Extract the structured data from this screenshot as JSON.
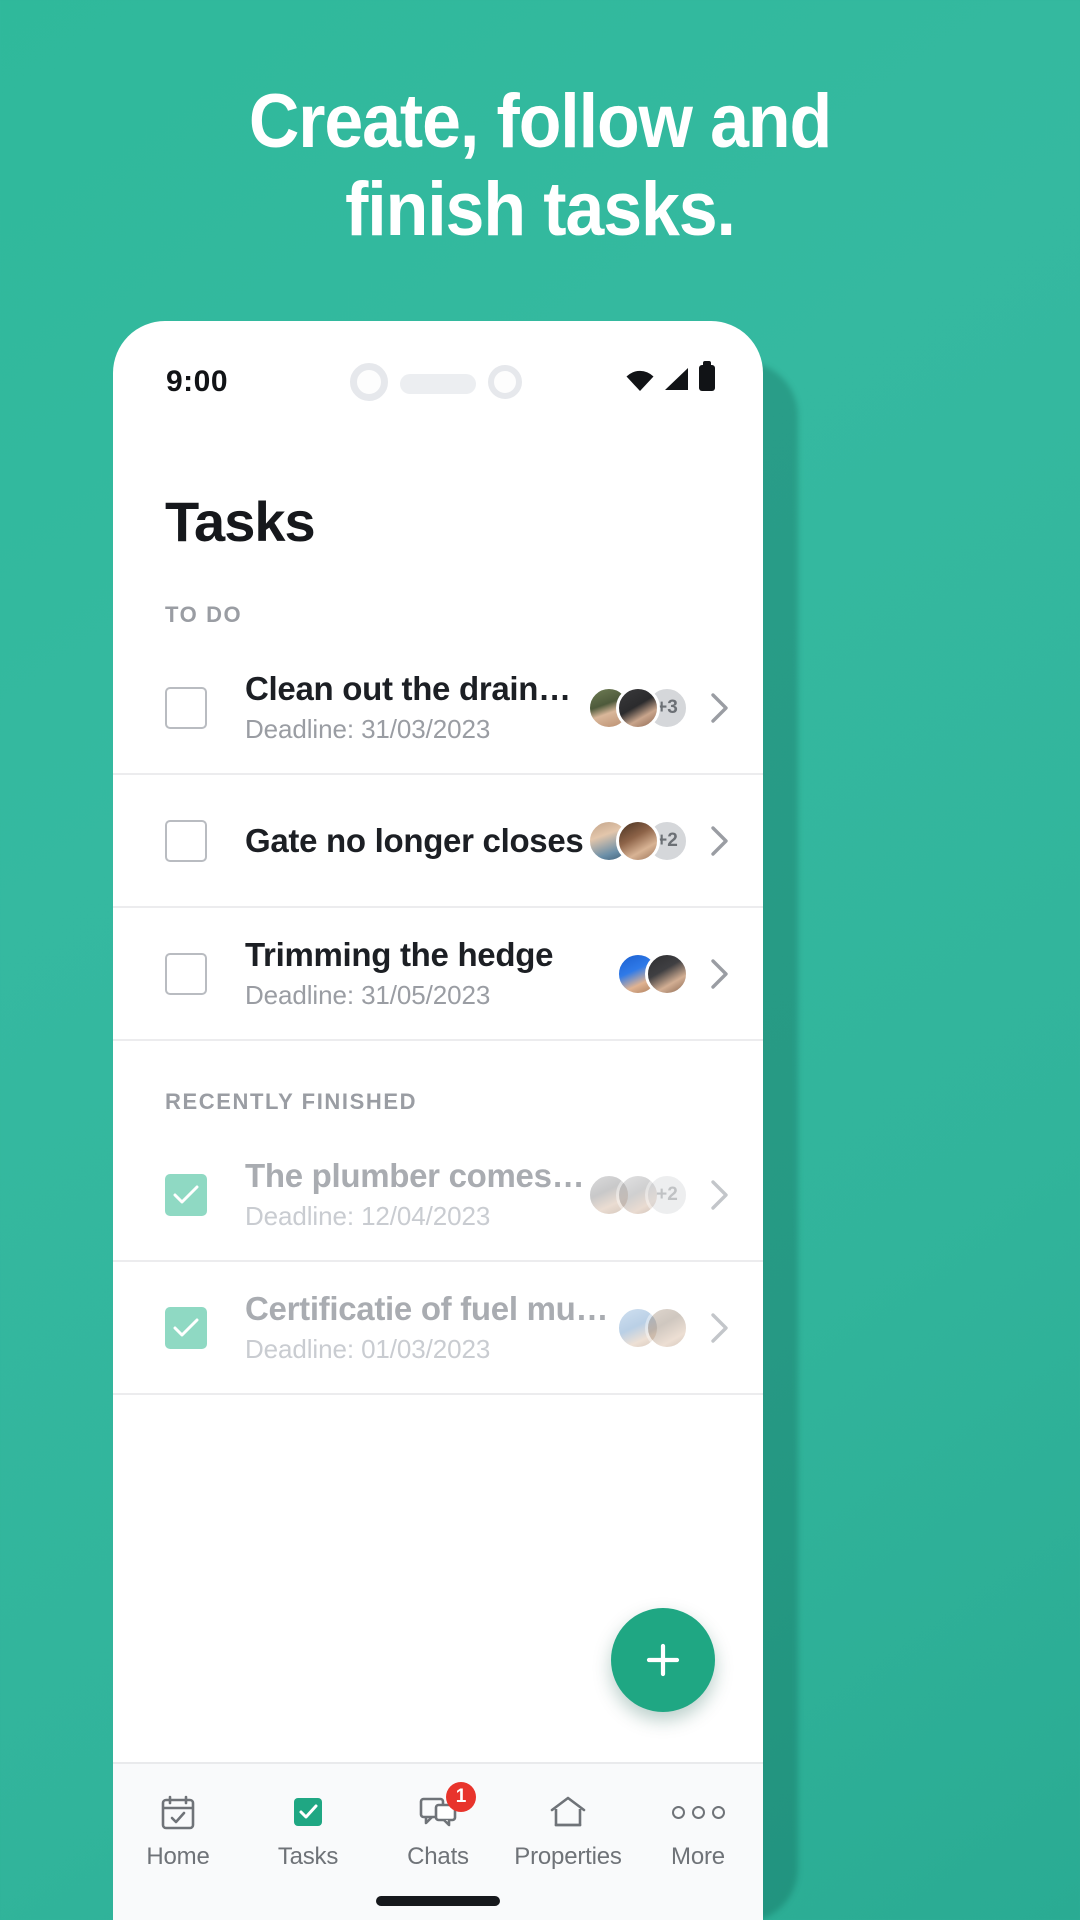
{
  "promo": {
    "headline_line1": "Create, follow and",
    "headline_line2": "finish tasks.",
    "background_color": "#31b49b"
  },
  "phone": {
    "status_bar": {
      "time": "9:00",
      "wifi_icon": "wifi-icon",
      "signal_icon": "cellular-signal-icon",
      "battery_icon": "battery-full-icon"
    },
    "screen": {
      "page_title": "Tasks",
      "sections": [
        {
          "label": "TO DO",
          "tasks": [
            {
              "title": "Clean out the drainpipe",
              "deadline": "Deadline: 31/03/2023",
              "completed": false,
              "avatars": [
                "face-1",
                "face-2"
              ],
              "avatar_overflow": "+3"
            },
            {
              "title": "Gate no longer closes",
              "deadline": "",
              "completed": false,
              "avatars": [
                "face-3",
                "face-4"
              ],
              "avatar_overflow": "+2"
            },
            {
              "title": "Trimming the hedge",
              "deadline": "Deadline: 31/05/2023",
              "completed": false,
              "avatars": [
                "face-5",
                "face-6"
              ],
              "avatar_overflow": ""
            }
          ]
        },
        {
          "label": "RECENTLY FINISHED",
          "tasks": [
            {
              "title": "The plumber comes by",
              "deadline": "Deadline: 12/04/2023",
              "completed": true,
              "avatars": [
                "face-7",
                "face-8"
              ],
              "avatar_overflow": "+2"
            },
            {
              "title": "Certificatie of fuel must ...",
              "deadline": "Deadline: 01/03/2023",
              "completed": true,
              "avatars": [
                "face-9",
                "face-10"
              ],
              "avatar_overflow": ""
            }
          ]
        }
      ],
      "fab": {
        "icon": "plus-icon",
        "color": "#1fa783"
      },
      "tabbar": {
        "items": [
          {
            "label": "Home",
            "icon": "calendar-check-icon",
            "active": false,
            "badge": ""
          },
          {
            "label": "Tasks",
            "icon": "checkbox-filled-icon",
            "active": true,
            "badge": ""
          },
          {
            "label": "Chats",
            "icon": "chat-bubbles-icon",
            "active": false,
            "badge": "1"
          },
          {
            "label": "Properties",
            "icon": "house-icon",
            "active": false,
            "badge": ""
          },
          {
            "label": "More",
            "icon": "ellipsis-icon",
            "active": false,
            "badge": ""
          }
        ],
        "active_color": "#1fa783",
        "badge_color": "#e8342c"
      }
    }
  }
}
